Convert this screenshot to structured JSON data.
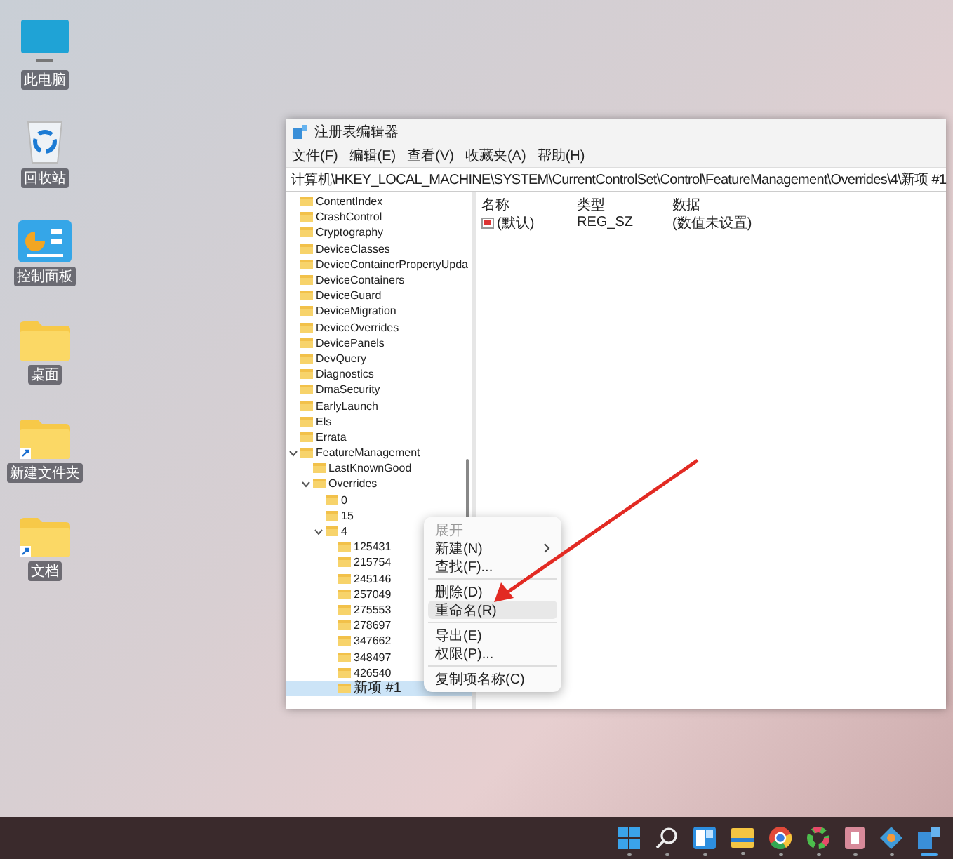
{
  "desktop_icons": [
    {
      "label": "此电脑",
      "kind": "monitor"
    },
    {
      "label": "回收站",
      "kind": "recycle"
    },
    {
      "label": "控制面板",
      "kind": "panel"
    },
    {
      "label": "桌面",
      "kind": "folder"
    },
    {
      "label": "新建文件夹",
      "kind": "shortcut-folder"
    },
    {
      "label": "文档",
      "kind": "shortcut-folder"
    }
  ],
  "window": {
    "title": "注册表编辑器"
  },
  "menu_bar": [
    "文件(F)",
    "编辑(E)",
    "查看(V)",
    "收藏夹(A)",
    "帮助(H)"
  ],
  "address": "计算机\\HKEY_LOCAL_MACHINE\\SYSTEM\\CurrentControlSet\\Control\\FeatureManagement\\Overrides\\4\\新项 #1",
  "tree": [
    {
      "label": "ContentIndex",
      "selected": false
    },
    {
      "label": "CrashControl",
      "selected": false
    },
    {
      "label": "Cryptography",
      "selected": false
    },
    {
      "label": "DeviceClasses",
      "selected": false
    },
    {
      "label": "DeviceContainerPropertyUpda",
      "selected": false
    },
    {
      "label": "DeviceContainers",
      "selected": false
    },
    {
      "label": "DeviceGuard",
      "selected": false
    },
    {
      "label": "DeviceMigration",
      "selected": false
    },
    {
      "label": "DeviceOverrides",
      "selected": false
    },
    {
      "label": "DevicePanels",
      "selected": false
    },
    {
      "label": "DevQuery",
      "selected": false
    },
    {
      "label": "Diagnostics",
      "selected": false
    },
    {
      "label": "DmaSecurity",
      "selected": false
    },
    {
      "label": "EarlyLaunch",
      "selected": false
    },
    {
      "label": "Els",
      "selected": false
    },
    {
      "label": "Errata",
      "selected": false
    },
    {
      "label": "FeatureManagement",
      "expanded": true,
      "selected": false,
      "children": [
        {
          "label": "LastKnownGood",
          "selected": false
        },
        {
          "label": "Overrides",
          "expanded": true,
          "selected": false,
          "children": [
            {
              "label": "0",
              "selected": false
            },
            {
              "label": "15",
              "selected": false
            },
            {
              "label": "4",
              "expanded": true,
              "selected": false,
              "children": [
                {
                  "label": "125431",
                  "selected": false
                },
                {
                  "label": "215754",
                  "selected": false
                },
                {
                  "label": "245146",
                  "selected": false
                },
                {
                  "label": "257049",
                  "selected": false
                },
                {
                  "label": "275553",
                  "selected": false
                },
                {
                  "label": "278697",
                  "selected": false
                },
                {
                  "label": "347662",
                  "selected": false
                },
                {
                  "label": "348497",
                  "selected": false
                },
                {
                  "label": "426540",
                  "selected": false
                },
                {
                  "label": "新项 #1",
                  "selected": true
                }
              ]
            }
          ]
        }
      ]
    }
  ],
  "values_table": {
    "columns": [
      "名称",
      "类型",
      "数据"
    ],
    "rows": [
      {
        "name": "(默认)",
        "type": "REG_SZ",
        "data": "(数值未设置)"
      }
    ]
  },
  "context_menu": [
    {
      "label": "展开",
      "kind": "item",
      "disabled": true,
      "selected": false
    },
    {
      "label": "新建(N)",
      "kind": "submenu",
      "disabled": false,
      "selected": false
    },
    {
      "label": "查找(F)...",
      "kind": "item",
      "disabled": false,
      "selected": false
    },
    {
      "kind": "separator"
    },
    {
      "label": "删除(D)",
      "kind": "item",
      "disabled": false,
      "selected": false
    },
    {
      "label": "重命名(R)",
      "kind": "item",
      "disabled": false,
      "selected": true
    },
    {
      "kind": "separator"
    },
    {
      "label": "导出(E)",
      "kind": "item",
      "disabled": false,
      "selected": false
    },
    {
      "label": "权限(P)...",
      "kind": "item",
      "disabled": false,
      "selected": false
    },
    {
      "kind": "separator"
    },
    {
      "label": "复制项名称(C)",
      "kind": "item",
      "disabled": false,
      "selected": false
    }
  ],
  "taskbar": [
    {
      "kind": "start",
      "active": false
    },
    {
      "kind": "search",
      "active": false
    },
    {
      "kind": "widgets",
      "active": false
    },
    {
      "kind": "explorer",
      "active": false
    },
    {
      "kind": "chrome",
      "active": false
    },
    {
      "kind": "ring",
      "active": false
    },
    {
      "kind": "app-pink",
      "active": false
    },
    {
      "kind": "app-blue",
      "active": false
    },
    {
      "kind": "regedit",
      "active": true
    }
  ]
}
